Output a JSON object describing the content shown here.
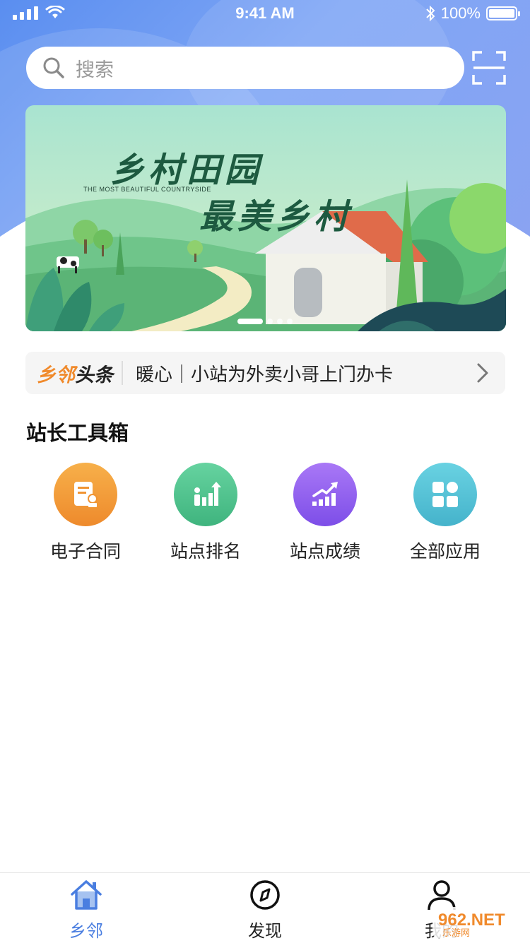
{
  "status_bar": {
    "time": "9:41 AM",
    "battery": "100%"
  },
  "search": {
    "placeholder": "搜索"
  },
  "banner": {
    "title_line1": "乡村田园",
    "subtitle": "THE MOST BEAUTIFUL COUNTRYSIDE",
    "title_line2": "最美乡村",
    "page_count": 4,
    "active_page": 1
  },
  "news": {
    "brand_part1": "乡邻",
    "brand_part2": "头条",
    "headline": "暖心｜小站为外卖小哥上门办卡"
  },
  "toolbox": {
    "title": "站长工具箱",
    "items": [
      {
        "label": "电子合同",
        "icon": "contract-icon",
        "color": "#f39a3a"
      },
      {
        "label": "站点排名",
        "icon": "ranking-icon",
        "color": "#4fc38f"
      },
      {
        "label": "站点成绩",
        "icon": "performance-icon",
        "color": "#8e5cf0"
      },
      {
        "label": "全部应用",
        "icon": "all-apps-icon",
        "color": "#55c2d6"
      }
    ]
  },
  "tabbar": {
    "items": [
      {
        "label": "乡邻",
        "icon": "home-icon",
        "active": true
      },
      {
        "label": "发现",
        "icon": "compass-icon",
        "active": false
      },
      {
        "label": "我的",
        "icon": "user-icon",
        "active": false
      }
    ],
    "active_color": "#4a7ee0"
  },
  "watermark": {
    "text": "962.NET",
    "subtext": "乐游网"
  }
}
